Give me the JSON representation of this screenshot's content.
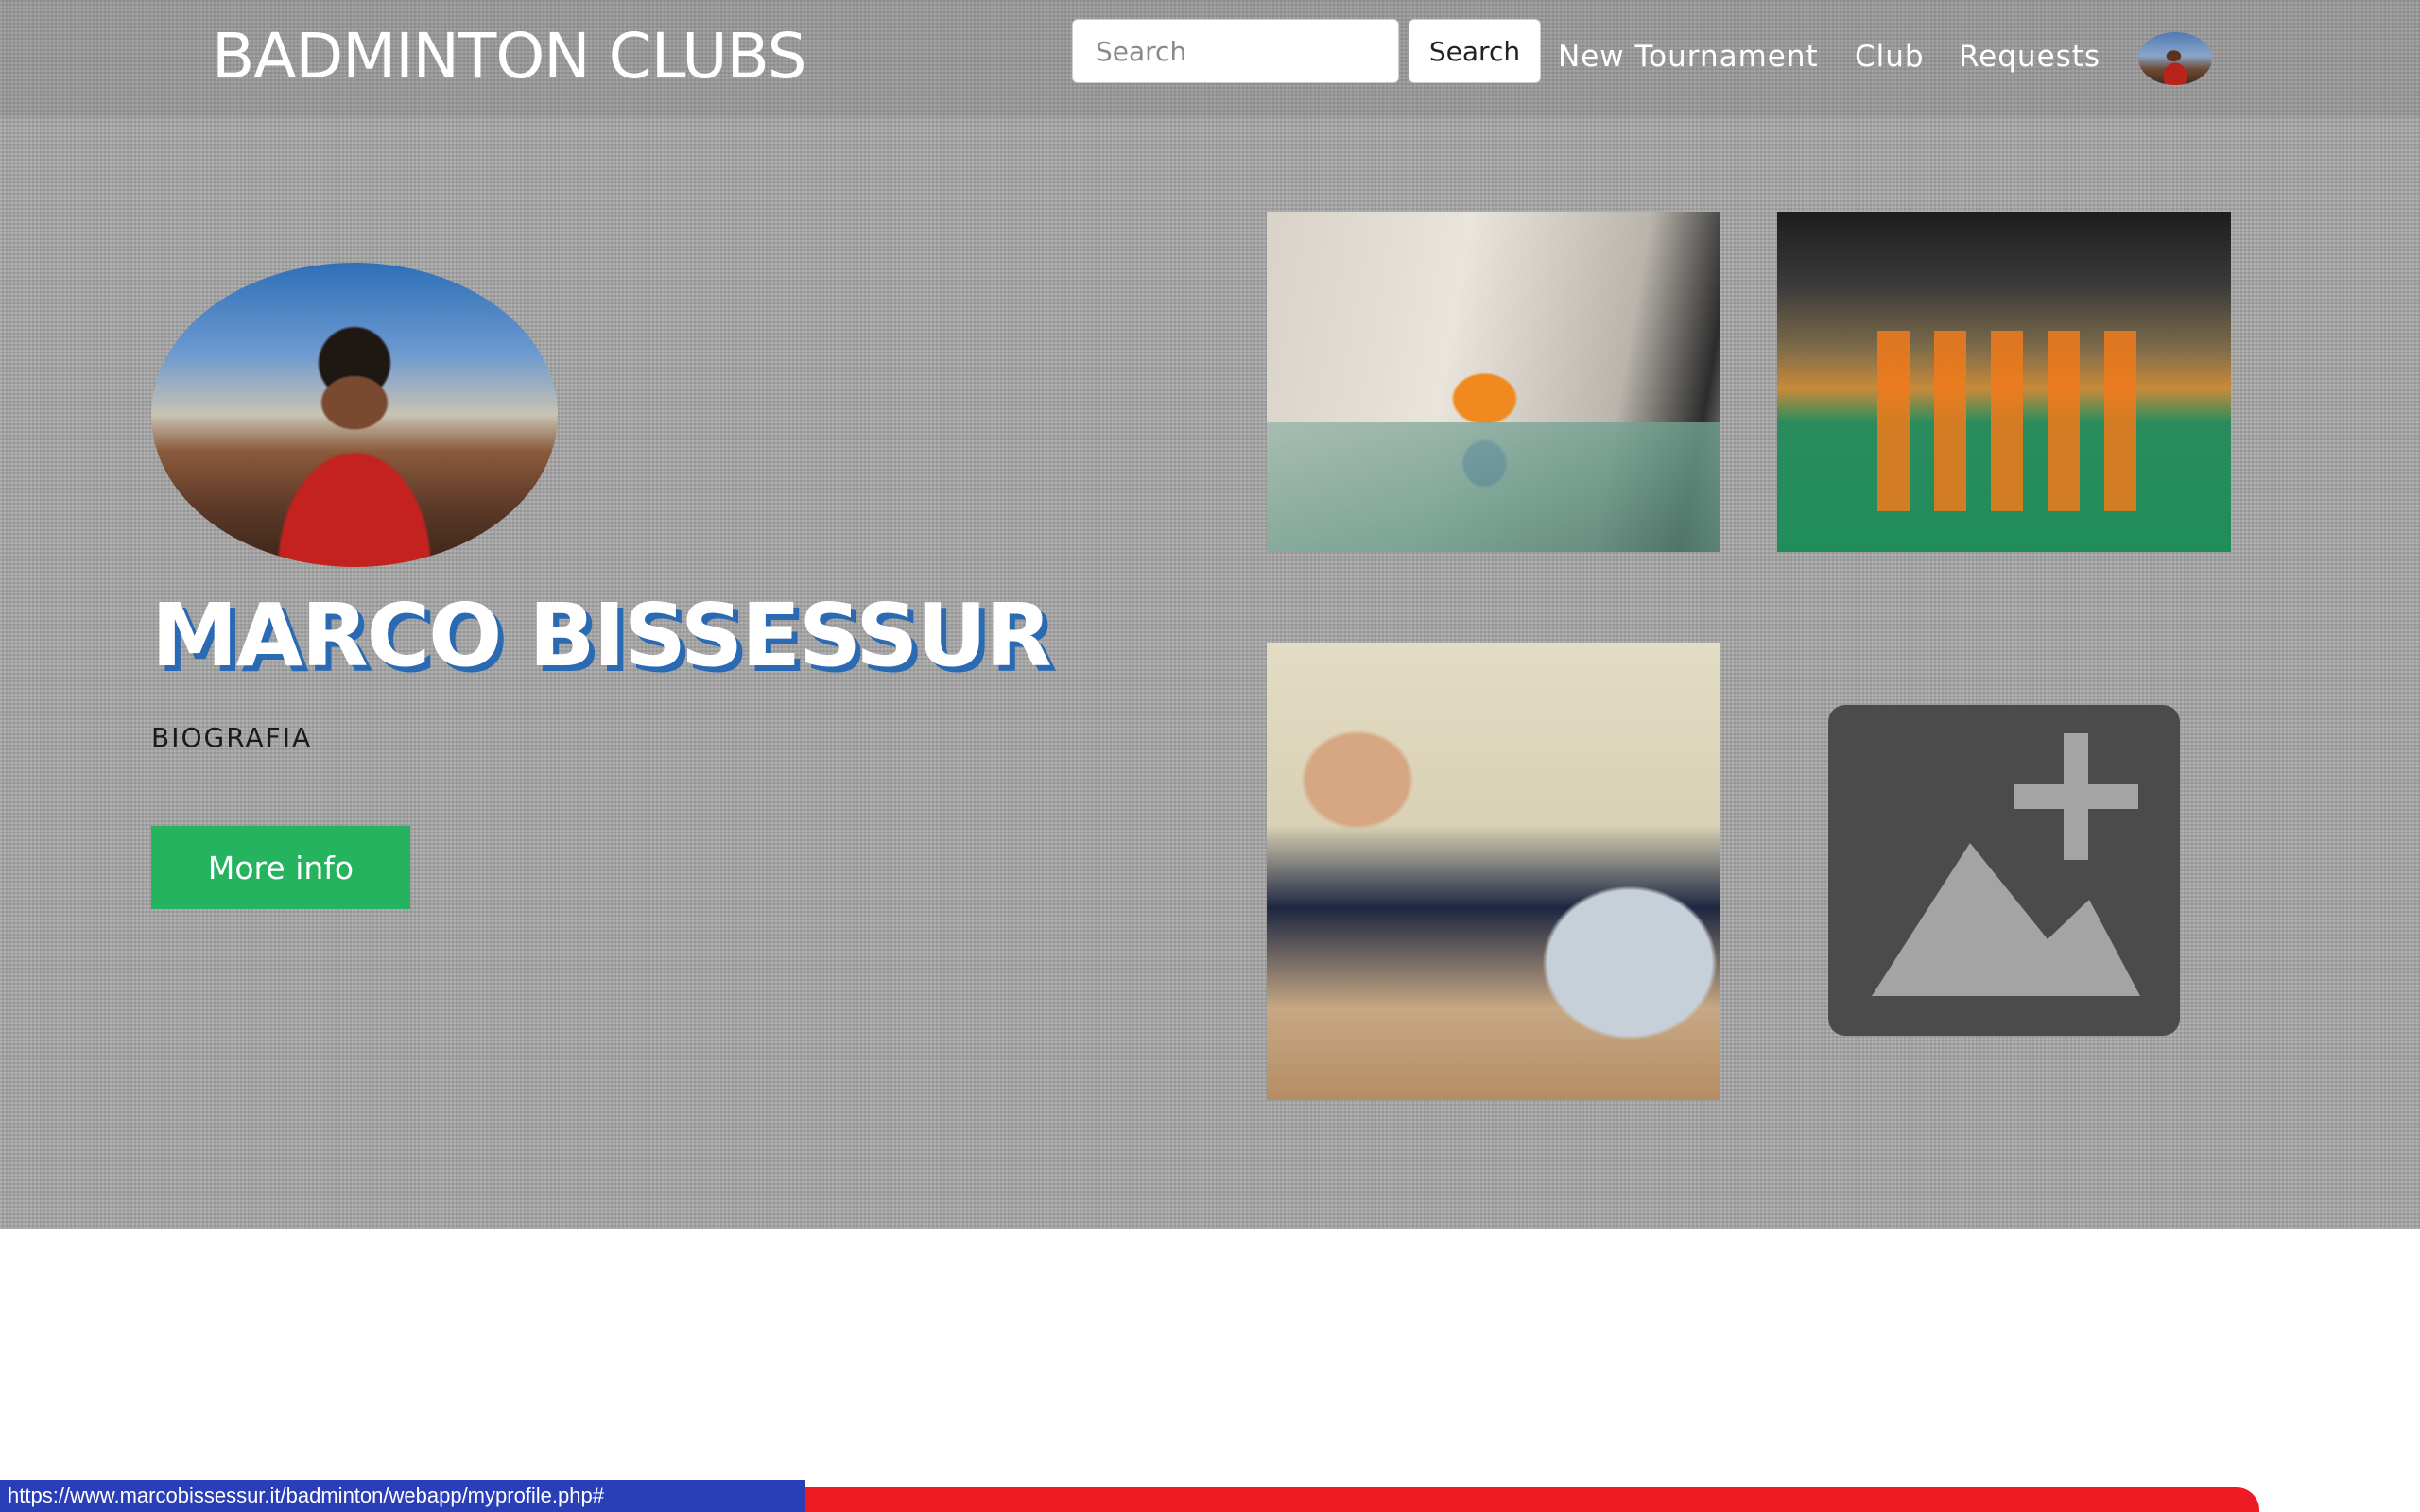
{
  "navbar": {
    "brand": "BADMINTON CLUBS",
    "search_placeholder": "Search",
    "search_button": "Search",
    "links": [
      "New Tournament",
      "Club",
      "Requests"
    ],
    "avatar_icon": "user-avatar"
  },
  "profile": {
    "name": "MARCO BISSESSUR",
    "bio": "BIOGRAFIA",
    "more_info": "More info"
  },
  "gallery": {
    "add_photo_icon": "add-photo-icon"
  },
  "status_bar": {
    "url": "https://www.marcobissessur.it/badminton/webapp/myprofile.php#"
  },
  "colors": {
    "button_green": "#26b35f",
    "name_shadow": "#2a6ab3",
    "status_blue": "#2a3fb7",
    "status_red": "#ee1b24"
  }
}
